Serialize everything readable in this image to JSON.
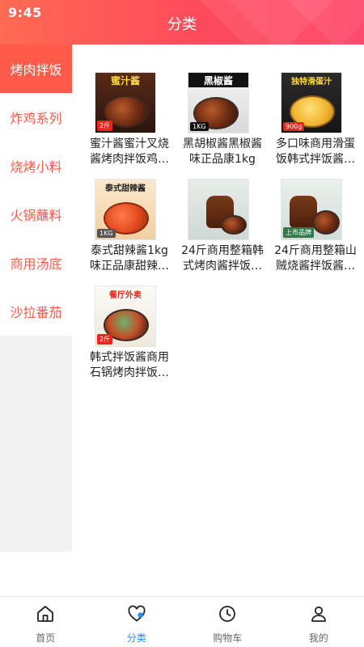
{
  "status": {
    "time": "9:45"
  },
  "header": {
    "title": "分类"
  },
  "sidebar": {
    "items": [
      {
        "label": "烤肉拌饭",
        "active": true
      },
      {
        "label": "炸鸡系列",
        "active": false
      },
      {
        "label": "烧烤小料",
        "active": false
      },
      {
        "label": "火锅蘸料",
        "active": false
      },
      {
        "label": "商用汤底",
        "active": false
      },
      {
        "label": "沙拉番茄",
        "active": false
      }
    ]
  },
  "products": [
    {
      "name": "蜜汁酱蜜汁叉烧酱烤肉拌饭鸡…",
      "thumb_text": "蜜汁酱",
      "thumb_color": "#3b2a20"
    },
    {
      "name": "黑胡椒酱黑椒酱味正品康1kg火…",
      "thumb_text": "黑椒酱",
      "thumb_color": "#2b2b2b"
    },
    {
      "name": "多口味商用滑蛋饭韩式拌饭酱…",
      "thumb_text": "独特滑蛋汁",
      "thumb_color": "#f2c14a"
    },
    {
      "name": "泰式甜辣酱1kg味正品康甜辣…",
      "thumb_text": "泰式甜辣酱",
      "thumb_color": "#f6e6c7"
    },
    {
      "name": "24斤商用整箱韩式烤肉酱拌饭…",
      "thumb_text": "",
      "thumb_color": "#dfe7e4"
    },
    {
      "name": "24斤商用整箱山贼烧酱拌饭酱…",
      "thumb_text": "",
      "thumb_color": "#e6ece8"
    },
    {
      "name": "韩式拌饭酱商用石锅烤肉拌饭…",
      "thumb_text": "餐厅外卖",
      "thumb_color": "#f4f1ea"
    }
  ],
  "tabbar": {
    "items": [
      {
        "label": "首页",
        "icon": "home-icon",
        "active": false
      },
      {
        "label": "分类",
        "icon": "heart-icon",
        "active": true
      },
      {
        "label": "购物车",
        "icon": "clock-icon",
        "active": false
      },
      {
        "label": "我的",
        "icon": "user-icon",
        "active": false
      }
    ]
  },
  "colors": {
    "accent": "#ff5a4a",
    "tab_active": "#1e90ff"
  }
}
